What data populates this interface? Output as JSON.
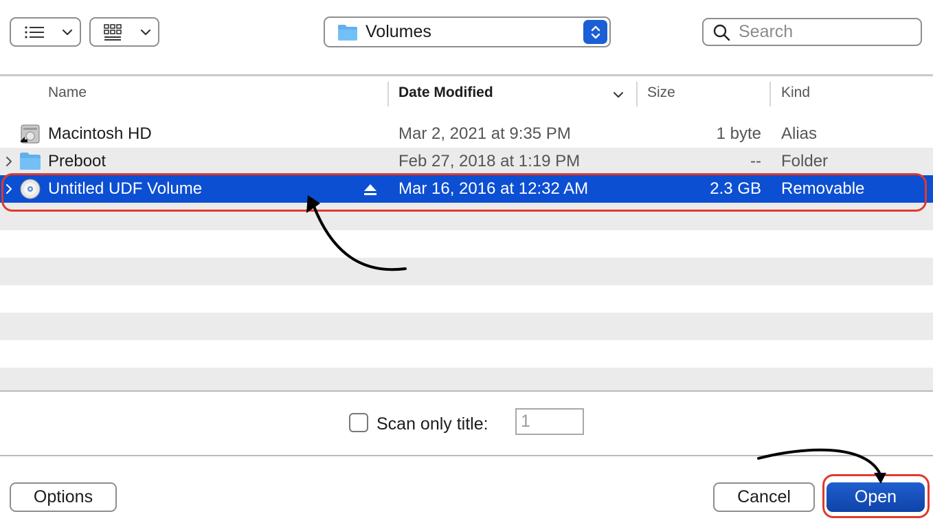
{
  "toolbar": {
    "view_list_icon": "list-view-icon",
    "view_grid_icon": "icon-grid-view-icon",
    "location": "Volumes",
    "search_placeholder": "Search"
  },
  "columns": {
    "name": "Name",
    "date_modified": "Date Modified",
    "size": "Size",
    "kind": "Kind"
  },
  "files": [
    {
      "name": "Macintosh HD",
      "date": "Mar 2, 2021 at 9:35 PM",
      "size": "1 byte",
      "kind": "Alias",
      "icon": "hard-drive-icon"
    },
    {
      "name": "Preboot",
      "date": "Feb 27, 2018 at 1:19 PM",
      "size": "--",
      "kind": "Folder",
      "icon": "folder-icon"
    },
    {
      "name": "Untitled UDF Volume",
      "date": "Mar 16, 2016 at 12:32 AM",
      "size": "2.3 GB",
      "kind": "Removable",
      "icon": "disc-icon"
    }
  ],
  "scan": {
    "label": "Scan only title:",
    "value": "1"
  },
  "buttons": {
    "options": "Options",
    "cancel": "Cancel",
    "open": "Open"
  },
  "colors": {
    "selection": "#0c4fd3",
    "accent": "#1b5fd6",
    "annotation_red": "#e0392b"
  }
}
